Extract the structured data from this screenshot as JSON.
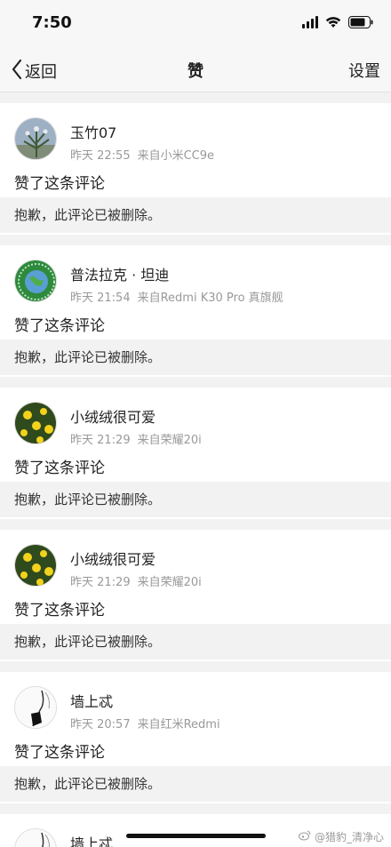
{
  "status": {
    "time": "7:50"
  },
  "nav": {
    "back_label": "返回",
    "title": "赞",
    "settings_label": "设置"
  },
  "items": [
    {
      "name": "玉竹07",
      "time": "昨天 22:55",
      "source": "来自小米CC9e",
      "action": "赞了这条评论",
      "quote": "抱歉，此评论已被删除。",
      "avatar": "plant-avatar"
    },
    {
      "name": "普法拉克 · 坦迪",
      "time": "昨天 21:54",
      "source": "来自Redmi K30 Pro 真旗舰",
      "action": "赞了这条评论",
      "quote": "抱歉，此评论已被删除。",
      "avatar": "globe-avatar"
    },
    {
      "name": "小绒绒很可爱",
      "time": "昨天 21:29",
      "source": "来自荣耀20i",
      "action": "赞了这条评论",
      "quote": "抱歉，此评论已被删除。",
      "avatar": "flower-avatar"
    },
    {
      "name": "小绒绒很可爱",
      "time": "昨天 21:29",
      "source": "来自荣耀20i",
      "action": "赞了这条评论",
      "quote": "抱歉，此评论已被删除。",
      "avatar": "flower-avatar"
    },
    {
      "name": "墙上忒",
      "time": "昨天 20:57",
      "source": "来自红米Redmi",
      "action": "赞了这条评论",
      "quote": "抱歉，此评论已被删除。",
      "avatar": "sketch-avatar"
    },
    {
      "name": "墙上忒",
      "avatar": "sketch-avatar"
    }
  ],
  "watermark": "@猎豹_清净心"
}
